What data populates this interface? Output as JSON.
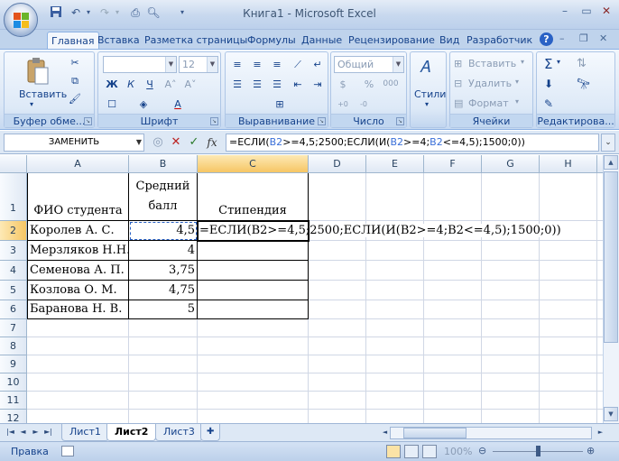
{
  "window": {
    "title": "Книга1 - Microsoft Excel"
  },
  "qat": {
    "icons": [
      "save-icon",
      "undo-icon",
      "redo-icon",
      "print-icon",
      "preview-icon",
      "customize-icon"
    ]
  },
  "tabs": [
    "Главная",
    "Вставка",
    "Разметка страницы",
    "Формулы",
    "Данные",
    "Рецензирование",
    "Вид",
    "Разработчик"
  ],
  "active_tab": "Главная",
  "ribbon": {
    "clipboard": {
      "label": "Буфер обме...",
      "paste": "Вставить"
    },
    "font": {
      "label": "Шрифт",
      "font_name": "",
      "font_size": "12",
      "bold": "Ж",
      "italic": "К",
      "underline": "Ч"
    },
    "alignment": {
      "label": "Выравнивание"
    },
    "number": {
      "label": "Число",
      "format": "Общий",
      "percent": "%",
      "thousands": "000"
    },
    "styles": {
      "label": "Стили"
    },
    "cells": {
      "label": "Ячейки",
      "insert": "Вставить",
      "delete": "Удалить",
      "format": "Формат"
    },
    "editing": {
      "label": "Редактирова..."
    }
  },
  "formula_bar": {
    "name_box": "ЗАМЕНИТЬ",
    "fx": "fx",
    "parts": [
      "=ЕСЛИ(",
      "B2",
      ">=4,5;2500;ЕСЛИ(И(",
      "B2",
      ">=4;",
      "B2",
      "<=4,5);1500;0))"
    ]
  },
  "columns": [
    "A",
    "B",
    "C",
    "D",
    "E",
    "F",
    "G",
    "H"
  ],
  "rows": [
    "1",
    "2",
    "3",
    "4",
    "5",
    "6",
    "7",
    "8",
    "9",
    "10",
    "11",
    "12"
  ],
  "cells": {
    "A1": "ФИО студента",
    "B1a": "Средний",
    "B1b": "балл",
    "C1": "Стипендия",
    "A2": "Королев А. С.",
    "B2": "4,5",
    "C2": "=ЕСЛИ(B2>=4,5;2500;ЕСЛИ(И(B2>=4;B2<=4,5);1500;0))",
    "A3": "Мерзляков Н.Н.",
    "B3": "4",
    "A4": "Семенова А. П.",
    "B4": "3,75",
    "A5": "Козлова О. М.",
    "B5": "4,75",
    "A6": "Баранова Н. В.",
    "B6": "5"
  },
  "sheets": [
    "Лист1",
    "Лист2",
    "Лист3"
  ],
  "active_sheet": "Лист2",
  "status": {
    "mode": "Правка",
    "zoom": "100%"
  },
  "colors": {
    "ribbon_bg": "#dbe7f6",
    "accent": "#15428b",
    "formula_ref": "#3a6fd8"
  }
}
